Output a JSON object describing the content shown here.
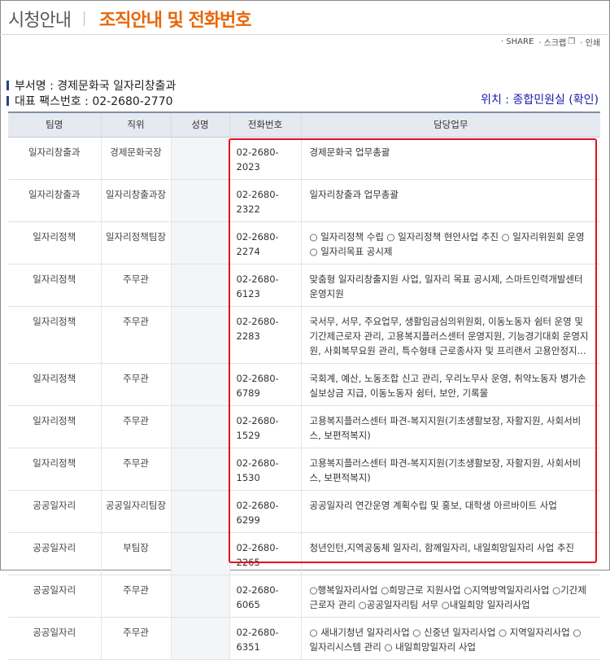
{
  "header": {
    "title": "시청안내",
    "subtitle": "조직안내 및 전화번호"
  },
  "toolbar": {
    "share": "· SHARE",
    "scrap": "· 스크랩",
    "print": "· 인쇄"
  },
  "info": {
    "dept": "부서명 : 경제문화국 일자리창출과",
    "fax": "대표 팩스번호 : 02-2680-2770",
    "location": "위치 : 종합민원실 (확인)"
  },
  "table": {
    "headers": [
      "팀명",
      "직위",
      "성명",
      "전화번호",
      "담당업무"
    ],
    "rows": [
      {
        "team": "일자리창출과",
        "position": "경제문화국장",
        "name": "",
        "phone": "02-2680-2023",
        "duty": "경제문화국 업무총괄"
      },
      {
        "team": "일자리창출과",
        "position": "일자리창출과장",
        "name": "",
        "phone": "02-2680-2322",
        "duty": "일자리창출과 업무총괄"
      },
      {
        "team": "일자리정책",
        "position": "일자리정책팀장",
        "name": "",
        "phone": "02-2680-2274",
        "duty": "○ 일자리정책 수립 ○ 일자리정책 현안사업 추진 ○ 일자리위원회 운영 ○ 일자리목표 공시제"
      },
      {
        "team": "일자리정책",
        "position": "주무관",
        "name": "",
        "phone": "02-2680-6123",
        "duty": "맞춤형 일자리창출지원 사업, 일자리 목표 공시제, 스마트인력개발센터 운영지원"
      },
      {
        "team": "일자리정책",
        "position": "주무관",
        "name": "",
        "phone": "02-2680-2283",
        "duty": "국서무, 서무, 주요업무, 생활임금심의위원회, 이동노동자 쉼터 운영 및 기간제근로자 관리, 고용복지플러스센터 운영지원, 기능경기대회 운영지원, 사회복무요원 관리, 특수형태 근로종사자 및 프리랜서 고용안정지..."
      },
      {
        "team": "일자리정책",
        "position": "주무관",
        "name": "",
        "phone": "02-2680-6789",
        "duty": "국회계, 예산, 노동조합 신고 관리, 우리노무사 운영, 취약노동자 병가손실보상금 지급, 이동노동자 쉼터, 보안, 기록물"
      },
      {
        "team": "일자리정책",
        "position": "주무관",
        "name": "",
        "phone": "02-2680-1529",
        "duty": "고용복지플러스센터 파견-복지지원(기초생활보장, 자활지원, 사회서비스, 보편적복지)"
      },
      {
        "team": "일자리정책",
        "position": "주무관",
        "name": "",
        "phone": "02-2680-1530",
        "duty": "고용복지플러스센터 파견-복지지원(기초생활보장, 자활지원, 사회서비스, 보편적복지)"
      },
      {
        "team": "공공일자리",
        "position": "공공일자리팀장",
        "name": "",
        "phone": "02-2680-6299",
        "duty": "공공일자리 연간운영 계획수립 및 홍보, 대학생 아르바이트 사업"
      },
      {
        "team": "공공일자리",
        "position": "부팀장",
        "name": "",
        "phone": "02-2680-2265",
        "duty": "청년인턴,지역공동체 일자리, 함께일자리, 내일희망일자리 사업 추진"
      },
      {
        "team": "공공일자리",
        "position": "주무관",
        "name": "",
        "phone": "02-2680-6065",
        "duty": "○행복일자리사업 ○희망근로 지원사업 ○지역방역일자리사업 ○기간제근로자 관리 ○공공일자리팀 서무 ○내일희망 일자리사업"
      },
      {
        "team": "공공일자리",
        "position": "주무관",
        "name": "",
        "phone": "02-2680-6351",
        "duty": "○ 새내기청년 일자리사업 ○ 신중년 일자리사업 ○ 지역일자리사업 ○ 일자리시스템 관리 ○ 내일희망일자리 사업"
      }
    ]
  },
  "colors": {
    "accent": "#e8670a",
    "bullet": "#2a3f8f",
    "link": "#1a1aa8",
    "highlight": "#e3101a"
  }
}
